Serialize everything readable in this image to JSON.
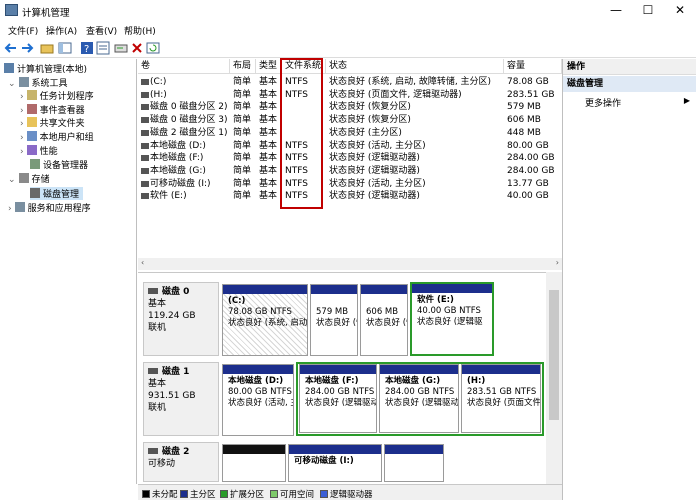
{
  "window": {
    "title": "计算机管理",
    "minimize": "—",
    "maximize": "☐",
    "close": "✕"
  },
  "menu": [
    "文件(F)",
    "操作(A)",
    "查看(V)",
    "帮助(H)"
  ],
  "tree": {
    "root": "计算机管理(本地)",
    "system_tools": "系统工具",
    "items": [
      "任务计划程序",
      "事件查看器",
      "共享文件夹",
      "本地用户和组",
      "性能",
      "设备管理器"
    ],
    "storage": "存储",
    "disk_mgmt": "磁盘管理",
    "services": "服务和应用程序"
  },
  "list": {
    "headers": [
      "卷",
      "布局",
      "类型",
      "文件系统",
      "状态",
      "容量"
    ],
    "rows": [
      {
        "vol": "(C:)",
        "layout": "简单",
        "type": "基本",
        "fs": "NTFS",
        "status": "状态良好 (系统, 启动, 故障转储, 主分区)",
        "cap": "78.08 GB"
      },
      {
        "vol": "(H:)",
        "layout": "简单",
        "type": "基本",
        "fs": "NTFS",
        "status": "状态良好 (页面文件, 逻辑驱动器)",
        "cap": "283.51 GB"
      },
      {
        "vol": "磁盘 0 磁盘分区 2)",
        "layout": "简单",
        "type": "基本",
        "fs": "",
        "status": "状态良好 (恢复分区)",
        "cap": "579 MB"
      },
      {
        "vol": "磁盘 0 磁盘分区 3)",
        "layout": "简单",
        "type": "基本",
        "fs": "",
        "status": "状态良好 (恢复分区)",
        "cap": "606 MB"
      },
      {
        "vol": "磁盘 2 磁盘分区 1)",
        "layout": "简单",
        "type": "基本",
        "fs": "",
        "status": "状态良好 (主分区)",
        "cap": "448 MB"
      },
      {
        "vol": "本地磁盘 (D:)",
        "layout": "简单",
        "type": "基本",
        "fs": "NTFS",
        "status": "状态良好 (活动, 主分区)",
        "cap": "80.00 GB"
      },
      {
        "vol": "本地磁盘 (F:)",
        "layout": "简单",
        "type": "基本",
        "fs": "NTFS",
        "status": "状态良好 (逻辑驱动器)",
        "cap": "284.00 GB"
      },
      {
        "vol": "本地磁盘 (G:)",
        "layout": "简单",
        "type": "基本",
        "fs": "NTFS",
        "status": "状态良好 (逻辑驱动器)",
        "cap": "284.00 GB"
      },
      {
        "vol": "可移动磁盘 (I:)",
        "layout": "简单",
        "type": "基本",
        "fs": "NTFS",
        "status": "状态良好 (活动, 主分区)",
        "cap": "13.77 GB"
      },
      {
        "vol": "软件 (E:)",
        "layout": "简单",
        "type": "基本",
        "fs": "NTFS",
        "status": "状态良好 (逻辑驱动器)",
        "cap": "40.00 GB"
      }
    ]
  },
  "disks": [
    {
      "name": "磁盘 0",
      "type": "基本",
      "size": "119.24 GB",
      "state": "联机",
      "parts": [
        {
          "l1": "(C:)",
          "l2": "78.08 GB NTFS",
          "l3": "状态良好 (系统, 启动"
        },
        {
          "l1": "",
          "l2": "579 MB",
          "l3": "状态良好 (恢"
        },
        {
          "l1": "",
          "l2": "606 MB",
          "l3": "状态良好 (恢"
        },
        {
          "l1": "软件 (E:)",
          "l2": "40.00 GB NTFS",
          "l3": "状态良好 (逻辑驱"
        }
      ]
    },
    {
      "name": "磁盘 1",
      "type": "基本",
      "size": "931.51 GB",
      "state": "联机",
      "parts": [
        {
          "l1": "本地磁盘 (D:)",
          "l2": "80.00 GB NTFS",
          "l3": "状态良好 (活动, 主"
        },
        {
          "l1": "本地磁盘 (F:)",
          "l2": "284.00 GB NTFS",
          "l3": "状态良好 (逻辑驱动"
        },
        {
          "l1": "本地磁盘 (G:)",
          "l2": "284.00 GB NTFS",
          "l3": "状态良好 (逻辑驱动"
        },
        {
          "l1": "(H:)",
          "l2": "283.51 GB NTFS",
          "l3": "状态良好 (页面文件"
        }
      ]
    },
    {
      "name": "磁盘 2",
      "type": "可移动",
      "parts": [
        {
          "l1": ""
        },
        {
          "l1": "可移动磁盘 (I:)"
        },
        {
          "l1": ""
        }
      ]
    }
  ],
  "legend": [
    "未分配",
    "主分区",
    "扩展分区",
    "可用空间",
    "逻辑驱动器"
  ],
  "legend_colors": [
    "#000000",
    "#1c2e8c",
    "#2a9a2a",
    "#7ec96a",
    "#3b5fd6"
  ],
  "actions": {
    "header": "操作",
    "section": "磁盘管理",
    "more": "更多操作"
  }
}
